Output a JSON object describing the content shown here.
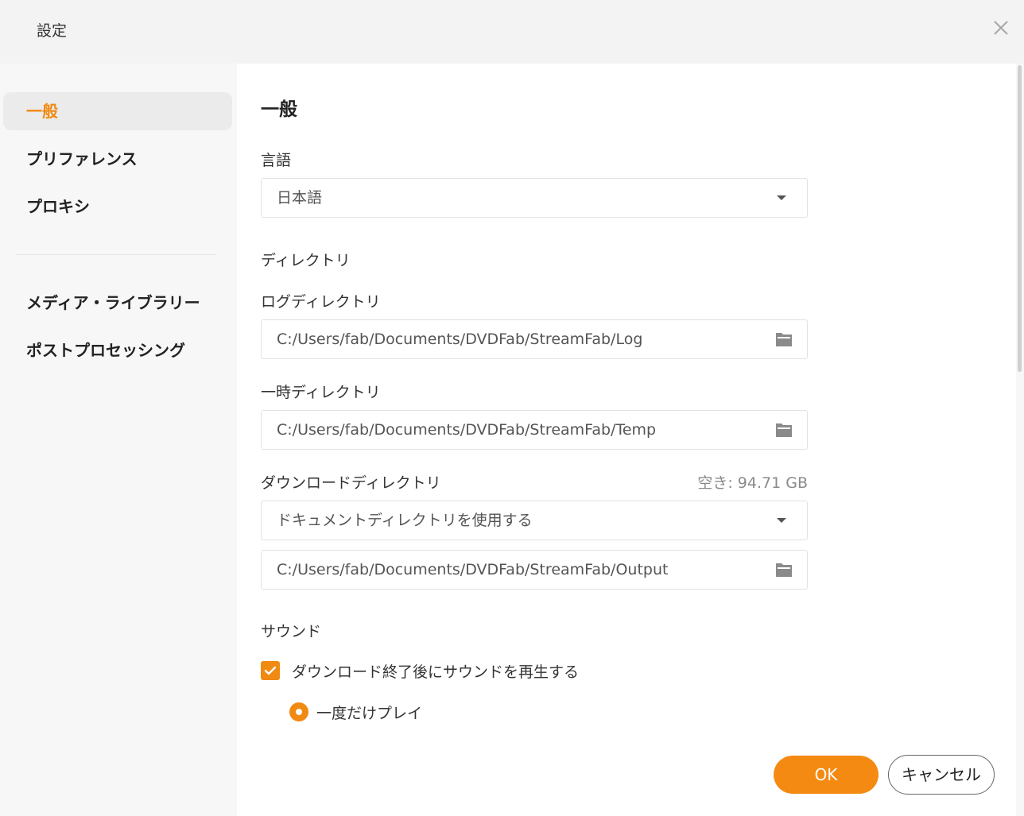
{
  "window": {
    "title": "設定"
  },
  "sidebar": {
    "items": [
      {
        "label": "一般",
        "active": true
      },
      {
        "label": "プリファレンス"
      },
      {
        "label": "プロキシ"
      },
      {
        "label": "メディア・ライブラリー"
      },
      {
        "label": "ポストプロセッシング"
      }
    ]
  },
  "main": {
    "heading": "一般",
    "language": {
      "label": "言語",
      "value": "日本語"
    },
    "directory": {
      "section_label": "ディレクトリ",
      "log": {
        "label": "ログディレクトリ",
        "path": "C:/Users/fab/Documents/DVDFab/StreamFab/Log"
      },
      "temp": {
        "label": "一時ディレクトリ",
        "path": "C:/Users/fab/Documents/DVDFab/StreamFab/Temp"
      },
      "download": {
        "label": "ダウンロードディレクトリ",
        "free_space": "空き: 94.71 GB",
        "mode": "ドキュメントディレクトリを使用する",
        "path": "C:/Users/fab/Documents/DVDFab/StreamFab/Output"
      }
    },
    "sound": {
      "section_label": "サウンド",
      "play_sound_label": "ダウンロード終了後にサウンドを再生する",
      "play_sound_checked": true,
      "play_once_label": "一度だけプレイ",
      "play_once_selected": true
    }
  },
  "footer": {
    "ok_label": "OK",
    "cancel_label": "キャンセル"
  },
  "colors": {
    "accent": "#f58a12",
    "sidebar_active_bg": "#ebebeb"
  }
}
